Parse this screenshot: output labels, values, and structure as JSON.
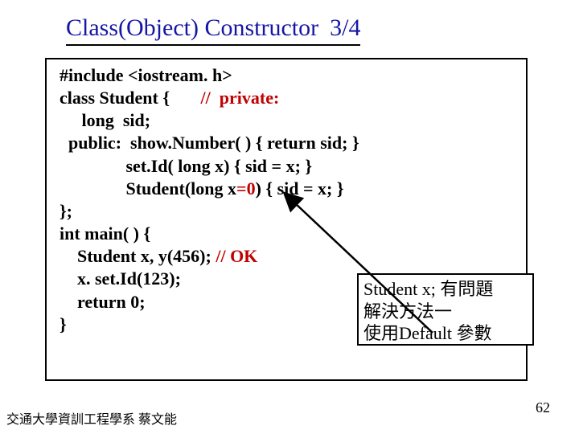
{
  "title": {
    "main": "Class(Object) Constructor",
    "part": "3/4"
  },
  "code": {
    "l1": "#include <iostream. h>",
    "l2a": "class Student {       ",
    "l2b": "//  private:",
    "l3": "     long  sid;",
    "l4": "  public:  show.Number( ) { return sid; }",
    "l5": "               set.Id( long x) { sid = x; }",
    "l6a": "               Student(long x",
    "l6b": "=0",
    "l6c": ") { sid = x; }",
    "l7": "};",
    "l8": "int main( ) {",
    "l9a": "    Student x, y(456); ",
    "l9b": "// OK",
    "l10": "    x. set.Id(123);",
    "l11": "    return 0;",
    "l12": "}"
  },
  "annotation": {
    "l1": "Student x; 有問題",
    "l2": " 解決方法一",
    "l3": "  使用Default 參數"
  },
  "pagenum": "62",
  "footer": "交通大學資訓工程學系 蔡文能"
}
